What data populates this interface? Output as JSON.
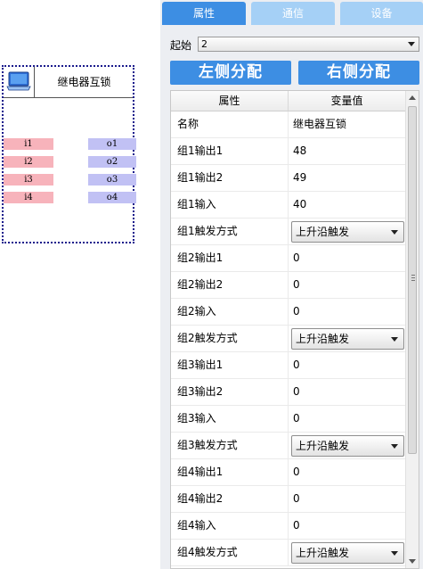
{
  "canvas": {
    "block": {
      "icon": "computer-icon",
      "title": "继电器互锁",
      "inputs": [
        "i1",
        "i2",
        "i3",
        "i4"
      ],
      "outputs": [
        "o1",
        "o2",
        "o3",
        "o4"
      ]
    }
  },
  "tabs": [
    {
      "label": "属性",
      "active": true
    },
    {
      "label": "通信",
      "active": false
    },
    {
      "label": "设备",
      "active": false
    }
  ],
  "start": {
    "label": "起始",
    "value": "2"
  },
  "buttons": {
    "left": "左侧分配",
    "right": "右侧分配"
  },
  "grid": {
    "headers": [
      "属性",
      "变量值"
    ],
    "rows": [
      {
        "name": "名称",
        "value": "继电器互锁",
        "type": "text"
      },
      {
        "name": "组1输出1",
        "value": "48",
        "type": "text"
      },
      {
        "name": "组1输出2",
        "value": "49",
        "type": "text"
      },
      {
        "name": "组1输入",
        "value": "40",
        "type": "text"
      },
      {
        "name": "组1触发方式",
        "value": "上升沿触发",
        "type": "dropdown"
      },
      {
        "name": "组2输出1",
        "value": "0",
        "type": "text"
      },
      {
        "name": "组2输出2",
        "value": "0",
        "type": "text"
      },
      {
        "name": "组2输入",
        "value": "0",
        "type": "text"
      },
      {
        "name": "组2触发方式",
        "value": "上升沿触发",
        "type": "dropdown"
      },
      {
        "name": "组3输出1",
        "value": "0",
        "type": "text"
      },
      {
        "name": "组3输出2",
        "value": "0",
        "type": "text"
      },
      {
        "name": "组3输入",
        "value": "0",
        "type": "text"
      },
      {
        "name": "组3触发方式",
        "value": "上升沿触发",
        "type": "dropdown"
      },
      {
        "name": "组4输出1",
        "value": "0",
        "type": "text"
      },
      {
        "name": "组4输出2",
        "value": "0",
        "type": "text"
      },
      {
        "name": "组4输入",
        "value": "0",
        "type": "text"
      },
      {
        "name": "组4触发方式",
        "value": "上升沿触发",
        "type": "dropdown"
      }
    ]
  },
  "colors": {
    "tab_active": "#3d8ee3",
    "tab_inactive": "#a5d0f6",
    "button": "#3d8ee3",
    "pin_in": "#f7b3bb",
    "pin_out": "#c1c1f4",
    "block_border": "#1a1a8c",
    "panel_bg": "#eceef2"
  }
}
